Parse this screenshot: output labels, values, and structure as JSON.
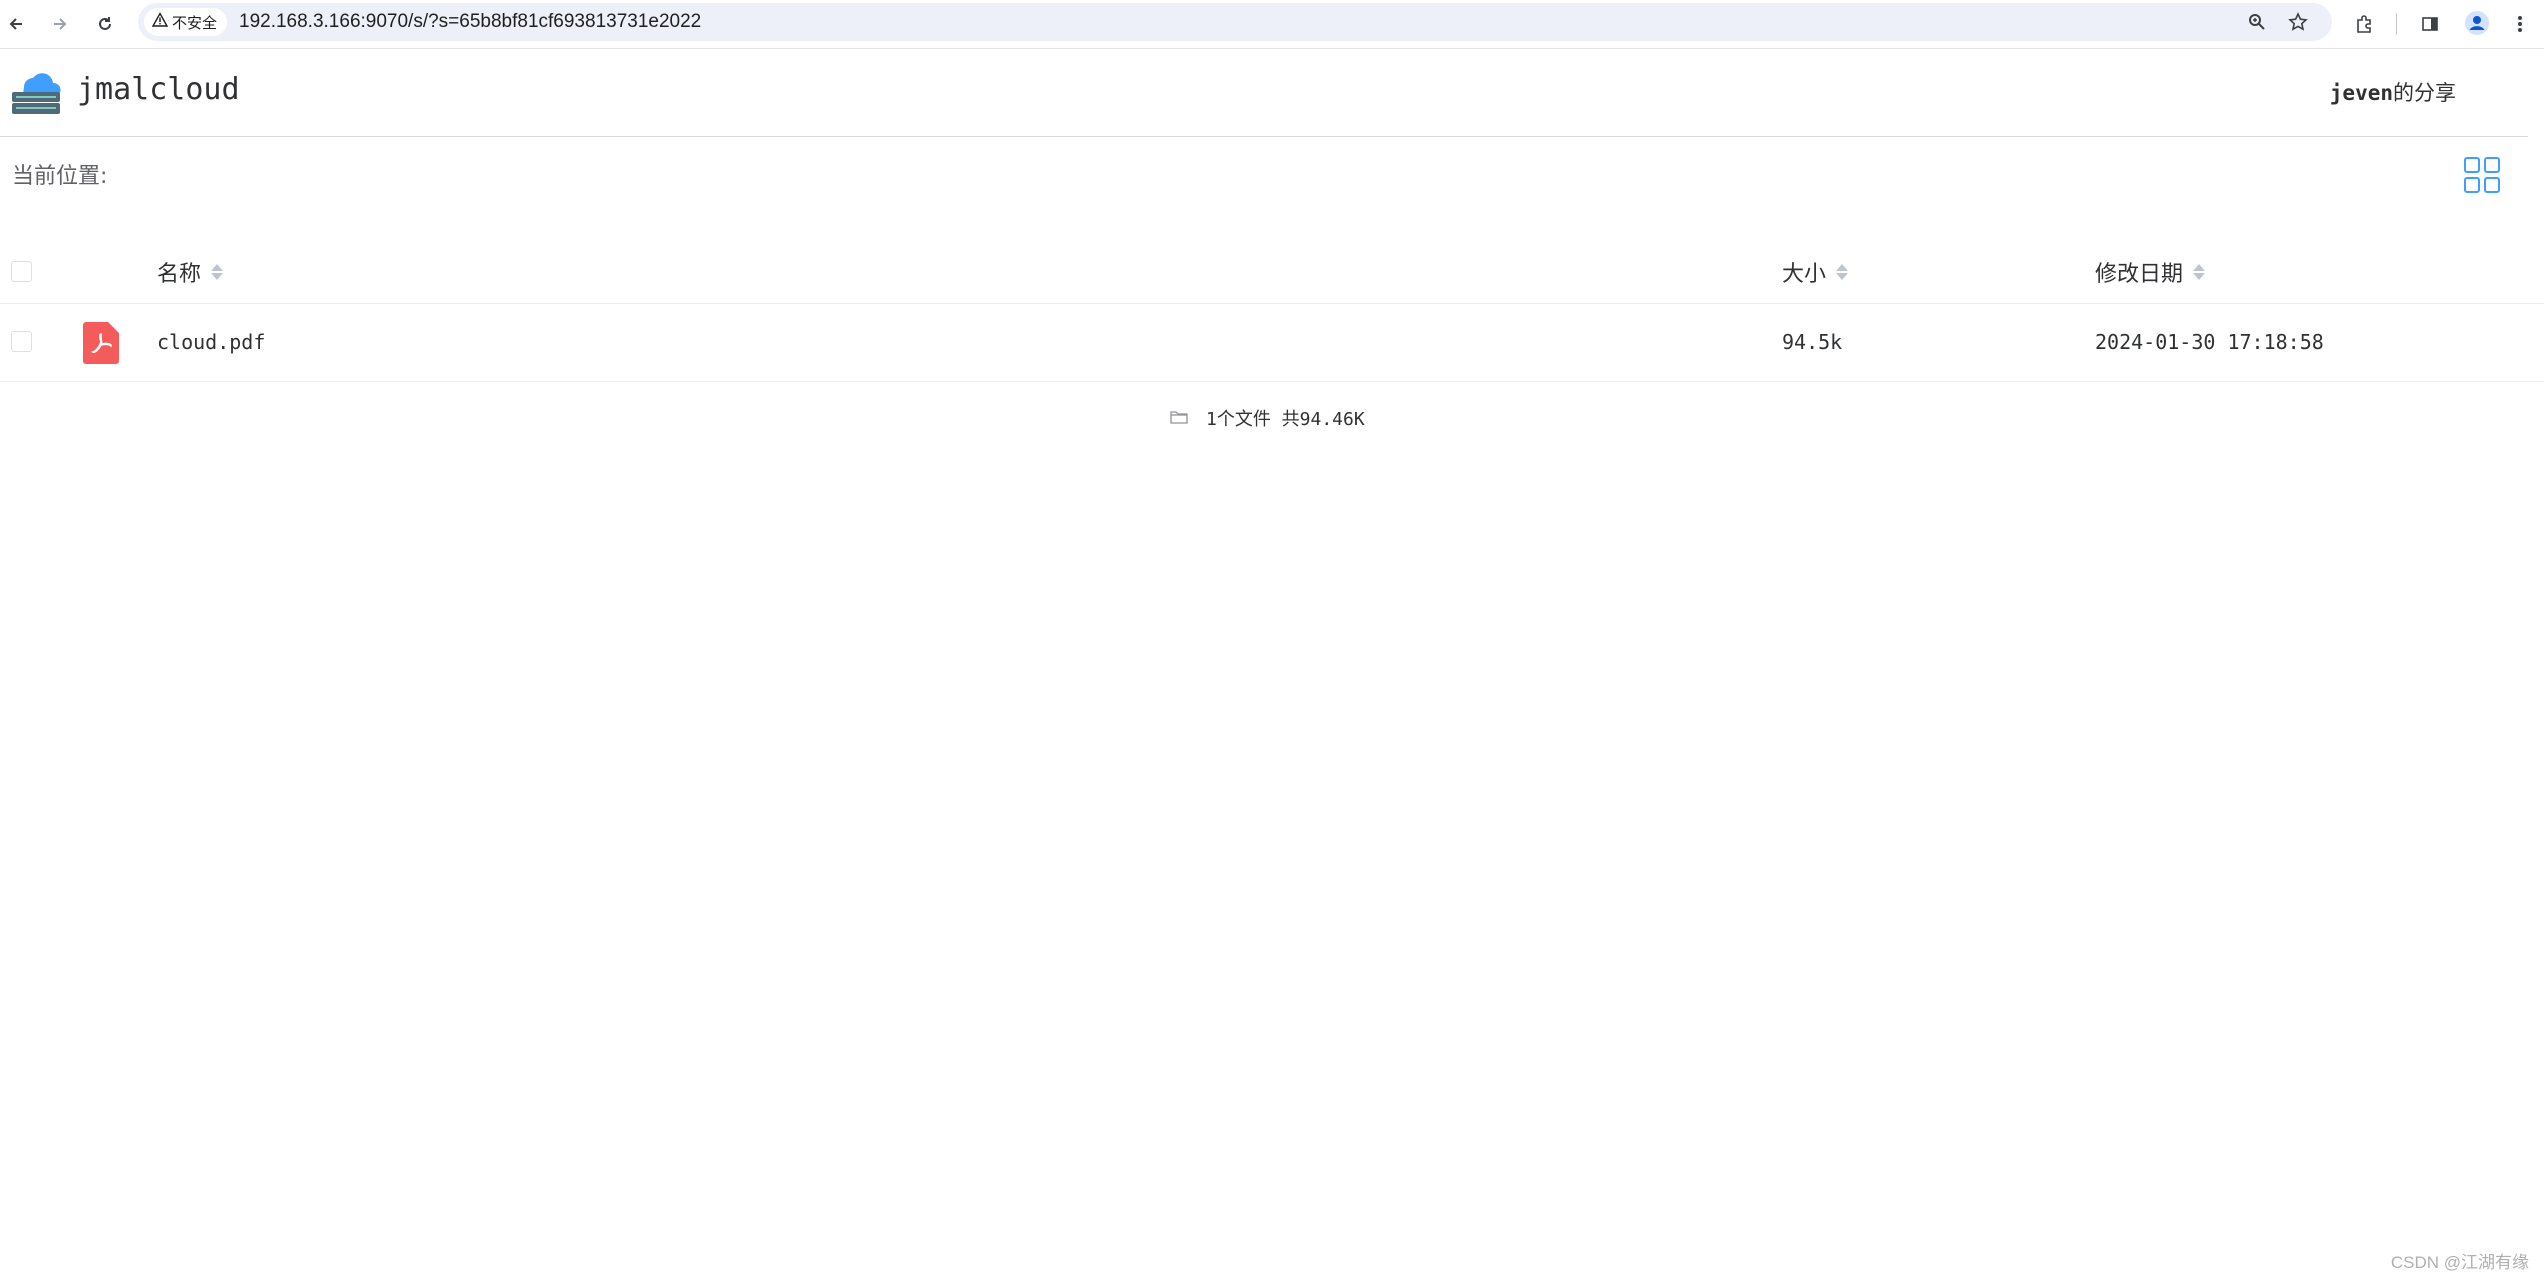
{
  "browser": {
    "security_label": "不安全",
    "url": "192.168.3.166:9070/s/?s=65b8bf81cf693813731e2022",
    "icons": [
      "back-icon",
      "forward-icon",
      "reload-icon",
      "warning-icon",
      "zoom-icon",
      "star-icon",
      "extensions-icon",
      "side-panel-icon",
      "profile-icon",
      "more-icon"
    ]
  },
  "header": {
    "app_name": "jmalcloud",
    "owner": "jeven",
    "owner_suffix": "的分享"
  },
  "breadcrumb": {
    "label": "当前位置:"
  },
  "table": {
    "columns": {
      "name": "名称",
      "size": "大小",
      "modified": "修改日期"
    },
    "rows": [
      {
        "name": "cloud.pdf",
        "size": "94.5k",
        "modified": "2024-01-30 17:18:58",
        "icon": "pdf-icon"
      }
    ]
  },
  "summary": {
    "text": "1个文件 共94.46K"
  },
  "watermark": "CSDN @江湖有缘",
  "colors": {
    "accent": "#409eff",
    "pdf_red": "#f45c5c",
    "border": "#ebeef5"
  }
}
